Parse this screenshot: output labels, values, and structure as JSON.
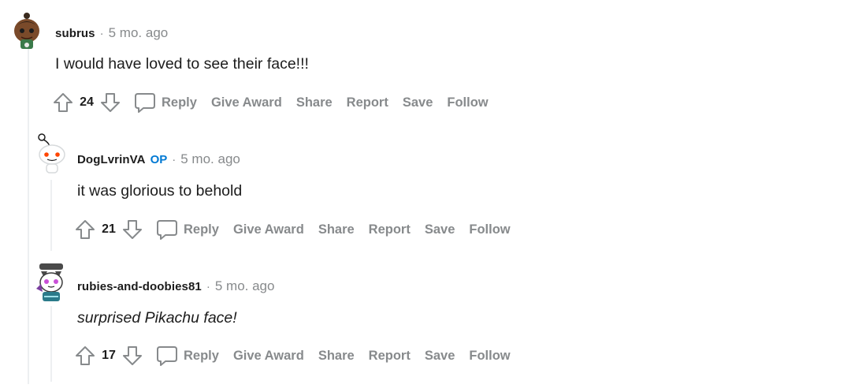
{
  "comments": [
    {
      "username": "subrus",
      "is_op": false,
      "separator": "·",
      "time": "5 mo. ago",
      "body": "I would have loved to see their face!!!",
      "italic": false,
      "score": "24",
      "actions": [
        "Reply",
        "Give Award",
        "Share",
        "Report",
        "Save",
        "Follow"
      ],
      "avatar_icon": "user-avatar-icon"
    },
    {
      "username": "DogLvrinVA",
      "is_op": true,
      "op_label": "OP",
      "separator": "·",
      "time": "5 mo. ago",
      "body": "it was glorious to behold",
      "italic": false,
      "score": "21",
      "actions": [
        "Reply",
        "Give Award",
        "Share",
        "Report",
        "Save",
        "Follow"
      ],
      "avatar_icon": "snoo-avatar-icon"
    },
    {
      "username": "rubies-and-doobies81",
      "is_op": false,
      "separator": "·",
      "time": "5 mo. ago",
      "body": "surprised Pikachu face!",
      "italic": true,
      "score": "17",
      "actions": [
        "Reply",
        "Give Award",
        "Share",
        "Report",
        "Save",
        "Follow"
      ],
      "avatar_icon": "cat-avatar-icon"
    }
  ],
  "colors": {
    "text": "#1c1c1c",
    "meta": "#878a8c",
    "op": "#0079d3",
    "thread_line": "#edeff1"
  }
}
